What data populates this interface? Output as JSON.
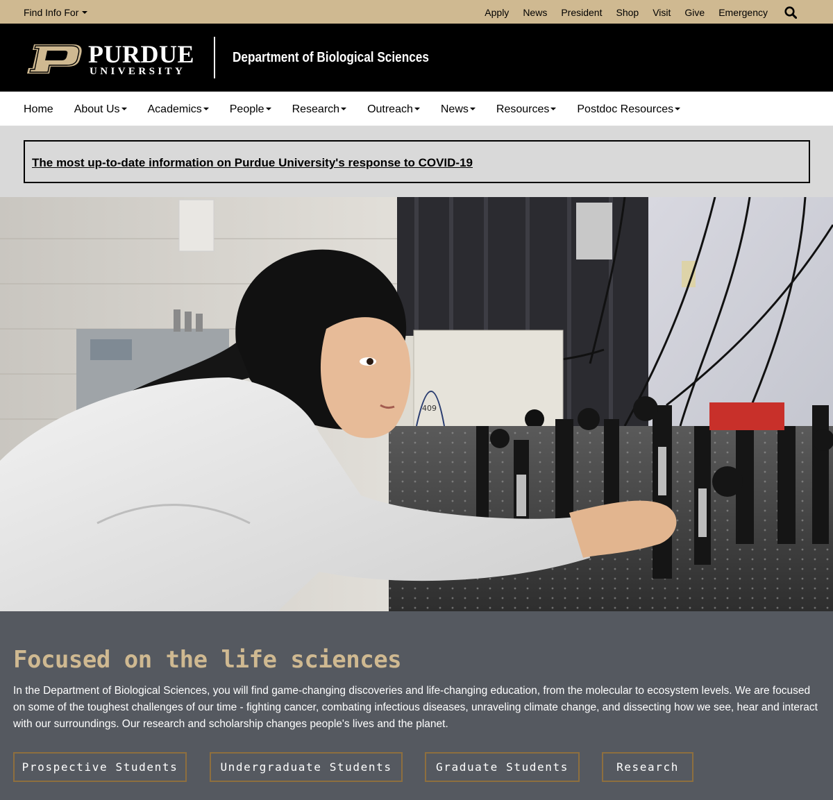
{
  "topbar": {
    "find_info": "Find Info For",
    "links": [
      "Apply",
      "News",
      "President",
      "Shop",
      "Visit",
      "Give",
      "Emergency"
    ],
    "search_icon": "search-icon"
  },
  "header": {
    "logo_word": "PURDUE",
    "logo_sub": "UNIVERSITY",
    "department": "Department of Biological Sciences"
  },
  "nav": {
    "items": [
      {
        "label": "Home",
        "dropdown": false
      },
      {
        "label": "About Us",
        "dropdown": true
      },
      {
        "label": "Academics",
        "dropdown": true
      },
      {
        "label": "People",
        "dropdown": true
      },
      {
        "label": "Research",
        "dropdown": true
      },
      {
        "label": "Outreach",
        "dropdown": true
      },
      {
        "label": "News",
        "dropdown": true
      },
      {
        "label": "Resources",
        "dropdown": true
      },
      {
        "label": "Postdoc Resources",
        "dropdown": true
      }
    ]
  },
  "alert": {
    "link_text": "The most up-to-date information on Purdue University's response to COVID-19"
  },
  "hero": {
    "photo_number": "409"
  },
  "intro": {
    "heading": "Focused on the life sciences",
    "body": "In the Department of Biological Sciences, you will find game-changing discoveries and life-changing education, from the molecular to ecosystem levels. We are focused on some of the toughest challenges of our time - fighting cancer, combating infectious diseases, unraveling climate change, and dissecting how we see, hear and interact with our surroundings. Our research and scholarship changes people's lives and the planet."
  },
  "buttons": [
    "Prospective Students",
    "Undergraduate Students",
    "Graduate Students",
    "Research"
  ],
  "colors": {
    "gold": "#cfb991",
    "black": "#000000",
    "gray_band": "#d9d9d9",
    "slate": "#555960",
    "button_border": "#8e6f3e"
  }
}
